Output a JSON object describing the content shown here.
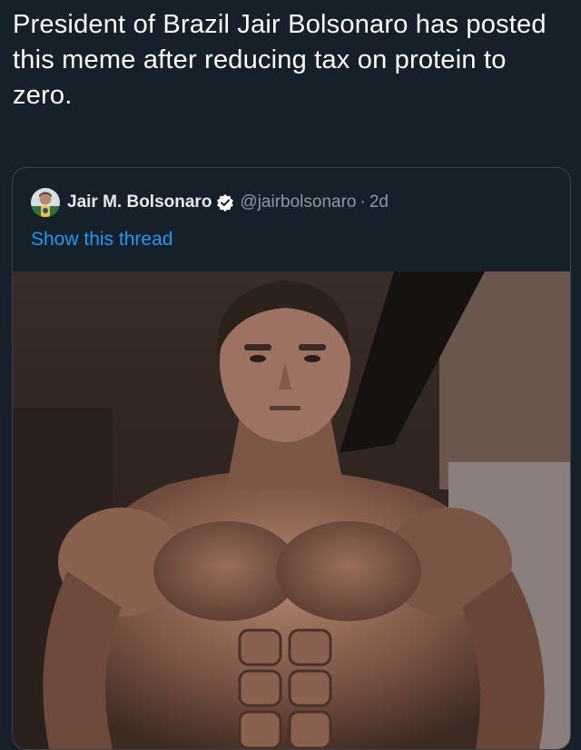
{
  "post": {
    "caption": "President of Brazil Jair Bolsonaro has posted this meme after reducing tax on protein to zero."
  },
  "quoted_tweet": {
    "display_name": "Jair M. Bolsonaro",
    "handle": "@jairbolsonaro",
    "separator": "·",
    "time": "2d",
    "show_thread_label": "Show this thread",
    "avatar_icon": "profile-avatar-icon",
    "verified_icon": "verified-badge-icon",
    "image": "bodybuilder-meme-photo"
  },
  "colors": {
    "background": "#15202b",
    "border": "#38444d",
    "link": "#1d9bf0",
    "muted": "#8b98a5",
    "text": "#ffffff"
  }
}
